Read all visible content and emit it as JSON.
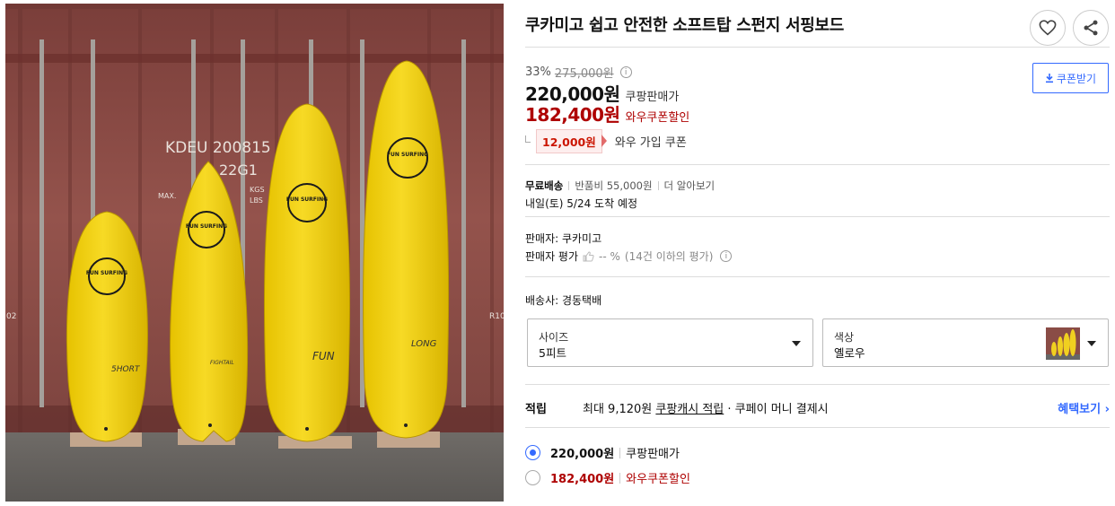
{
  "product": {
    "title": "쿠카미고 쉽고 안전한 소프트탑 스펀지 서핑보드",
    "image_alt": "Four yellow soft-top surfboards leaning against a red shipping container"
  },
  "photo": {
    "container_code": "KDEU 200815",
    "container_type": "22G1",
    "container_max": "MAX.",
    "container_kgs": "KGS",
    "container_lbs": "LBS",
    "container_left_tag": "02",
    "container_right_tag": "R10",
    "boards": [
      {
        "logo": "FUN SURFING",
        "label": "5HORT"
      },
      {
        "logo": "FUN SURFING",
        "label": "FIGHTAIL"
      },
      {
        "logo": "FUN SURFING",
        "label": "FUN"
      },
      {
        "logo": "FUN SURFING",
        "label": "LONG"
      }
    ]
  },
  "price": {
    "discount_percent": "33%",
    "original_price": "275,000원",
    "sale_price": "220,000원",
    "sale_label": "쿠팡판매가",
    "wow_price": "182,400원",
    "wow_label": "와우쿠폰할인",
    "wow_coupon_amount": "12,000원",
    "wow_coupon_text": "와우 가입 쿠폰",
    "coupon_button": "쿠폰받기",
    "info_icon_glyph": "i"
  },
  "shipping": {
    "free_label": "무료배송",
    "return_fee": "반품비 55,000원",
    "more": "더 알아보기",
    "arrival": "내일(토) 5/24 도착 예정"
  },
  "seller": {
    "name_line": "판매자: 쿠카미고",
    "rating_label": "판매자 평가",
    "rating_value": "-- %",
    "rating_note": "(14건 이하의 평가)"
  },
  "carrier": {
    "line": "배송사: 경동택배"
  },
  "options": {
    "size": {
      "label": "사이즈",
      "value": "5피트"
    },
    "color": {
      "label": "색상",
      "value": "옐로우"
    }
  },
  "reward": {
    "label": "적립",
    "desc_prefix": "최대 9,120원",
    "desc_link": "쿠팡캐시 적립",
    "desc_suffix": "· 쿠페이 머니 결제시",
    "more": "혜택보기 ›"
  },
  "price_options": [
    {
      "price": "220,000원",
      "label": "쿠팡판매가",
      "selected": true
    },
    {
      "price": "182,400원",
      "label": "와우쿠폰할인",
      "selected": false
    }
  ],
  "colors": {
    "accent_blue": "#346aff",
    "price_red": "#ae0000",
    "board_yellow": "#f2d21a",
    "container_red": "#8a4c46"
  }
}
